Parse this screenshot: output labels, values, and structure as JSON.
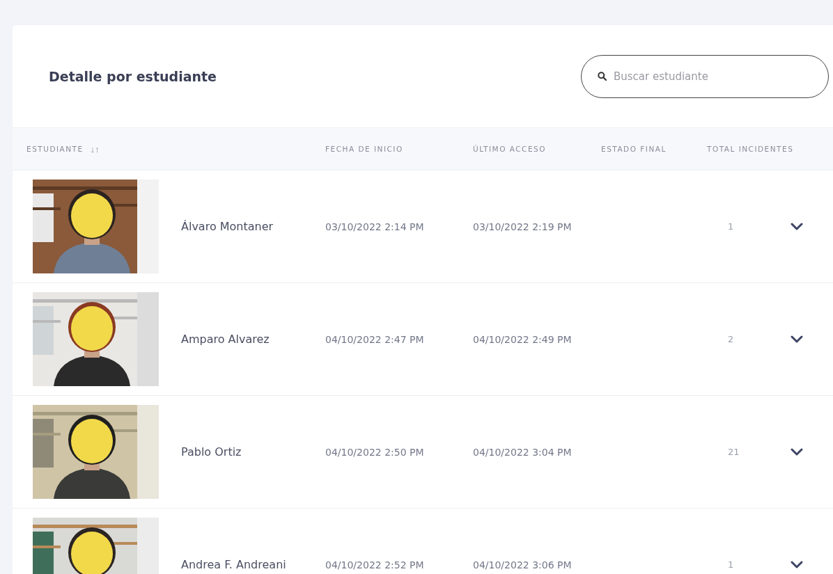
{
  "title": "Detalle por estudiante",
  "search": {
    "placeholder": "Buscar estudiante"
  },
  "table": {
    "columns": [
      {
        "label": "ESTUDIANTE",
        "sort_icon": "↓↑"
      },
      {
        "label": "FECHA DE INICIO"
      },
      {
        "label": "ÚLTIMO ACCESO"
      },
      {
        "label": "ESTADO FINAL"
      },
      {
        "label": "TOTAL INCIDENTES"
      }
    ],
    "rows": [
      {
        "name": "Álvaro Montaner",
        "start": "03/10/2022 2:14 PM",
        "last": "03/10/2022 2:19 PM",
        "incidents": "1"
      },
      {
        "name": "Amparo Alvarez",
        "start": "04/10/2022 2:47 PM",
        "last": "04/10/2022 2:49 PM",
        "incidents": "2"
      },
      {
        "name": "Pablo Ortiz",
        "start": "04/10/2022 2:50 PM",
        "last": "04/10/2022 3:04 PM",
        "incidents": "21"
      },
      {
        "name": "Andrea F. Andreani",
        "start": "04/10/2022 2:52 PM",
        "last": "04/10/2022 3:06 PM",
        "incidents": "1"
      }
    ]
  }
}
